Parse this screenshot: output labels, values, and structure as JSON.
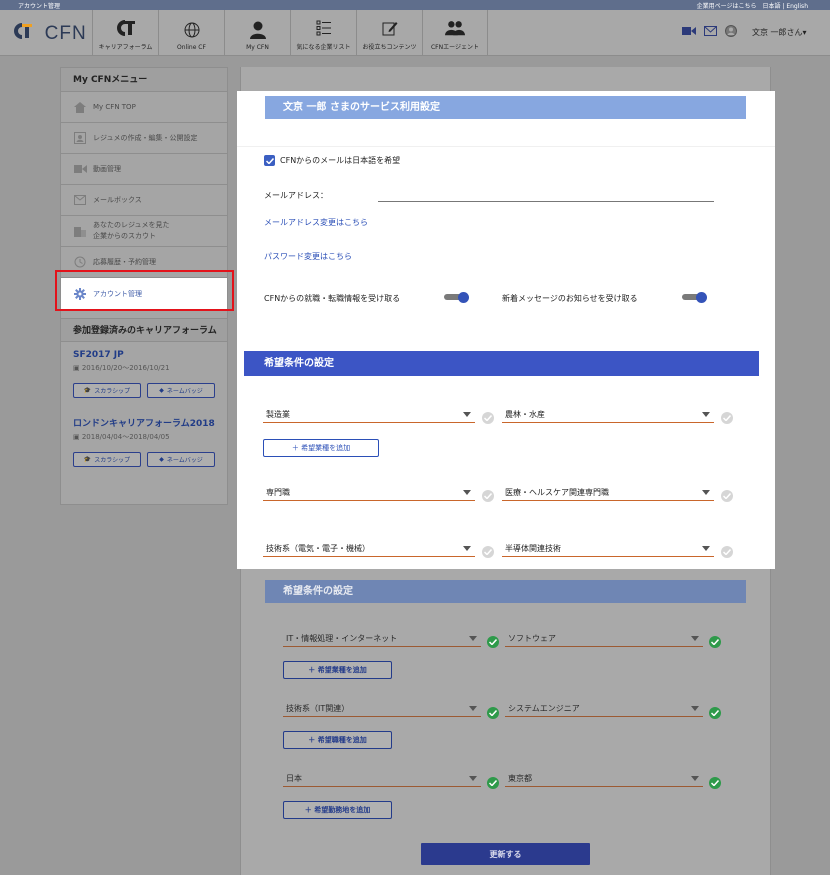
{
  "topbar": {
    "left": "アカウント管理",
    "right": "企業用ページはこちら　日本語 | English"
  },
  "logo": {
    "text": "CFN"
  },
  "nav": [
    {
      "label": "キャリアフォーラム",
      "icon": "cf-logo-icon"
    },
    {
      "label": "Online CF",
      "icon": "globe-icon"
    },
    {
      "label": "My CFN",
      "icon": "person-icon"
    },
    {
      "label": "気になる企業リスト",
      "icon": "list-icon"
    },
    {
      "label": "お役立ちコンテンツ",
      "icon": "pencil-icon"
    },
    {
      "label": "CFNエージェント",
      "icon": "people-icon"
    }
  ],
  "header_user": {
    "name": "文京 一郎さん▾"
  },
  "sidebar": {
    "title": "My CFNメニュー",
    "items": [
      {
        "label": "My CFN TOP",
        "icon": "home-icon"
      },
      {
        "label": "レジュメの作成・編集・公開設定",
        "icon": "resume-icon"
      },
      {
        "label": "動画管理",
        "icon": "video-icon"
      },
      {
        "label": "メールボックス",
        "icon": "mail-icon"
      },
      {
        "label": "あなたのレジュメを見た",
        "label2": "企業からのスカウト",
        "icon": "building-icon"
      },
      {
        "label": "応募履歴・予約管理",
        "icon": "history-icon"
      },
      {
        "label": "アカウント管理",
        "icon": "gear-icon"
      }
    ],
    "forums_title": "参加登録済みのキャリアフォーラム",
    "forums": [
      {
        "name": "SF2017 JP",
        "dates": "2016/10/20〜2016/10/21",
        "btn1": "スカラシップ",
        "btn2": "ネームバッジ"
      },
      {
        "name": "ロンドンキャリアフォーラム2018",
        "dates": "2018/04/04〜2018/04/05",
        "btn1": "スカラシップ",
        "btn2": "ネームバッジ"
      }
    ]
  },
  "service": {
    "title": "文京 一郎 さまのサービス利用設定",
    "japanese_mail": "CFNからのメールは日本語を希望",
    "email_label": "メールアドレス：",
    "email_value": "",
    "change_email": "メールアドレス変更はこちら",
    "change_password": "パスワード変更はこちら",
    "toggle1": "CFNからの就職・転職情報を受け取る",
    "toggle2": "新着メッセージのお知らせを受け取る"
  },
  "pref_focus": {
    "title": "希望条件の設定",
    "industry1": "製造業",
    "industry2": "農林・水産",
    "add_industry": "＋ 希望業種を追加",
    "job1": "専門職",
    "job2": "医療・ヘルスケア関連専門職",
    "job3": "技術系（電気・電子・機械）",
    "job4": "半導体関連技術"
  },
  "pref_bg": {
    "title": "希望条件の設定",
    "industry1": "IT・情報処理・インターネット",
    "industry2": "ソフトウェア",
    "add_industry": "＋ 希望業種を追加",
    "job1": "技術系（IT関連）",
    "job2": "システムエンジニア",
    "add_job": "＋ 希望職種を追加",
    "loc1": "日本",
    "loc2": "東京都",
    "add_loc": "＋ 希望勤務地を追加",
    "submit": "更新する"
  },
  "colors": {
    "accent": "#3c55c5",
    "link": "#2b4fb7",
    "check": "#2e9a4a",
    "highlight": "#e3121a"
  }
}
